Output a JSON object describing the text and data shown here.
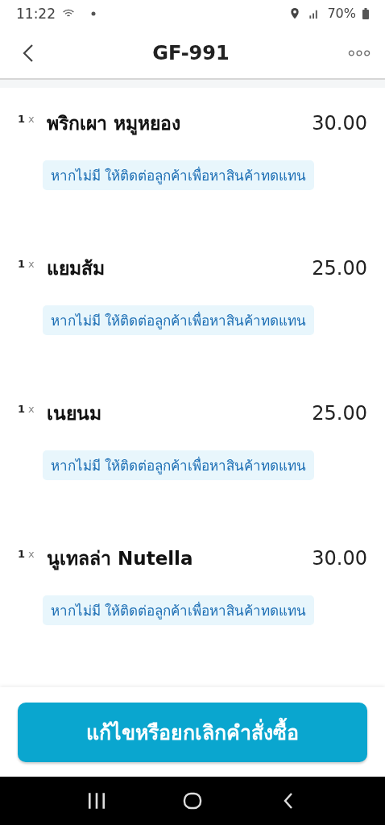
{
  "status_bar": {
    "time": "11:22",
    "battery": "70%"
  },
  "header": {
    "title": "GF-991"
  },
  "items": [
    {
      "qty": "1",
      "times": "x",
      "name": "พริกเผา หมูหยอง",
      "price": "30.00",
      "note": "หากไม่มี ให้ติดต่อลูกค้าเพื่อหาสินค้าทดแทน"
    },
    {
      "qty": "1",
      "times": "x",
      "name": "แยมส้ม",
      "price": "25.00",
      "note": "หากไม่มี ให้ติดต่อลูกค้าเพื่อหาสินค้าทดแทน"
    },
    {
      "qty": "1",
      "times": "x",
      "name": "เนยนม",
      "price": "25.00",
      "note": "หากไม่มี ให้ติดต่อลูกค้าเพื่อหาสินค้าทดแทน"
    },
    {
      "qty": "1",
      "times": "x",
      "name": "นูเทลล่า Nutella",
      "price": "30.00",
      "note": "หากไม่มี ให้ติดต่อลูกค้าเพื่อหาสินค้าทดแทน"
    }
  ],
  "action_button": "แก้ไขหรือยกเลิกคำสั่งซื้อ"
}
